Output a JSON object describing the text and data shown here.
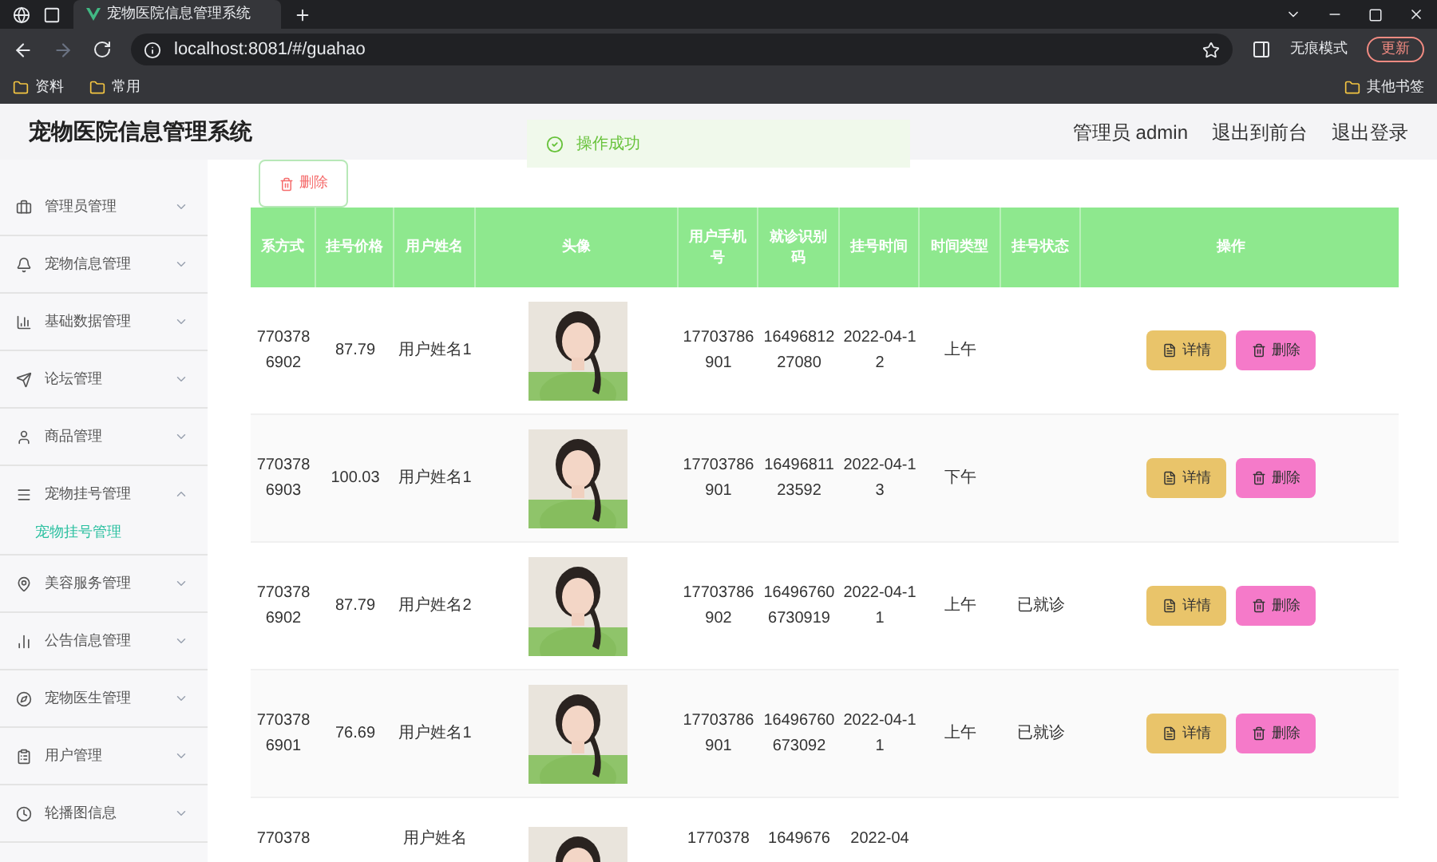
{
  "browser": {
    "tab_title": "宠物医院信息管理系统",
    "url": "localhost:8081/#/guahao",
    "incognito": "无痕模式",
    "update": "更新",
    "bookmarks": [
      "资料",
      "常用"
    ],
    "other_bookmarks": "其他书签"
  },
  "header": {
    "title": "宠物医院信息管理系统",
    "user": "管理员 admin",
    "links": [
      "退出到前台",
      "退出登录"
    ]
  },
  "toast": {
    "text": "操作成功"
  },
  "sidebar": {
    "items": [
      {
        "label": "管理员管理",
        "expanded": false
      },
      {
        "label": "宠物信息管理",
        "expanded": false
      },
      {
        "label": "基础数据管理",
        "expanded": false
      },
      {
        "label": "论坛管理",
        "expanded": false
      },
      {
        "label": "商品管理",
        "expanded": false
      },
      {
        "label": "宠物挂号管理",
        "expanded": true,
        "children": [
          {
            "label": "宠物挂号管理",
            "selected": true
          }
        ]
      },
      {
        "label": "美容服务管理",
        "expanded": false
      },
      {
        "label": "公告信息管理",
        "expanded": false
      },
      {
        "label": "宠物医生管理",
        "expanded": false
      },
      {
        "label": "用户管理",
        "expanded": false
      },
      {
        "label": "轮播图信息",
        "expanded": false
      }
    ]
  },
  "toolbar": {
    "delete": "删除"
  },
  "table": {
    "columns": [
      "系方式",
      "挂号价格",
      "用户姓名",
      "头像",
      "用户手机号",
      "就诊识别码",
      "挂号时间",
      "时间类型",
      "挂号状态",
      "操作"
    ],
    "rows": [
      {
        "cells": [
          "7703786902",
          "87.79",
          "用户姓名1",
          "",
          "17703786901",
          "1649681227080",
          "2022-04-12",
          "上午",
          ""
        ],
        "actions": [
          "详情",
          "删除"
        ]
      },
      {
        "cells": [
          "7703786903",
          "100.03",
          "用户姓名1",
          "",
          "17703786901",
          "1649681123592",
          "2022-04-13",
          "下午",
          ""
        ],
        "actions": [
          "详情",
          "删除"
        ]
      },
      {
        "cells": [
          "7703786902",
          "87.79",
          "用户姓名2",
          "",
          "17703786902",
          "164967606730919",
          "2022-04-11",
          "上午",
          "已就诊"
        ],
        "actions": [
          "详情",
          "删除"
        ]
      },
      {
        "cells": [
          "7703786901",
          "76.69",
          "用户姓名1",
          "",
          "17703786901",
          "16496760673092",
          "2022-04-11",
          "上午",
          "已就诊"
        ],
        "actions": [
          "详情",
          "删除"
        ]
      },
      {
        "cells": [
          "770378",
          "",
          "用户姓名",
          "",
          "1770378",
          "1649676",
          "2022-04",
          "",
          ""
        ],
        "actions": []
      }
    ]
  }
}
